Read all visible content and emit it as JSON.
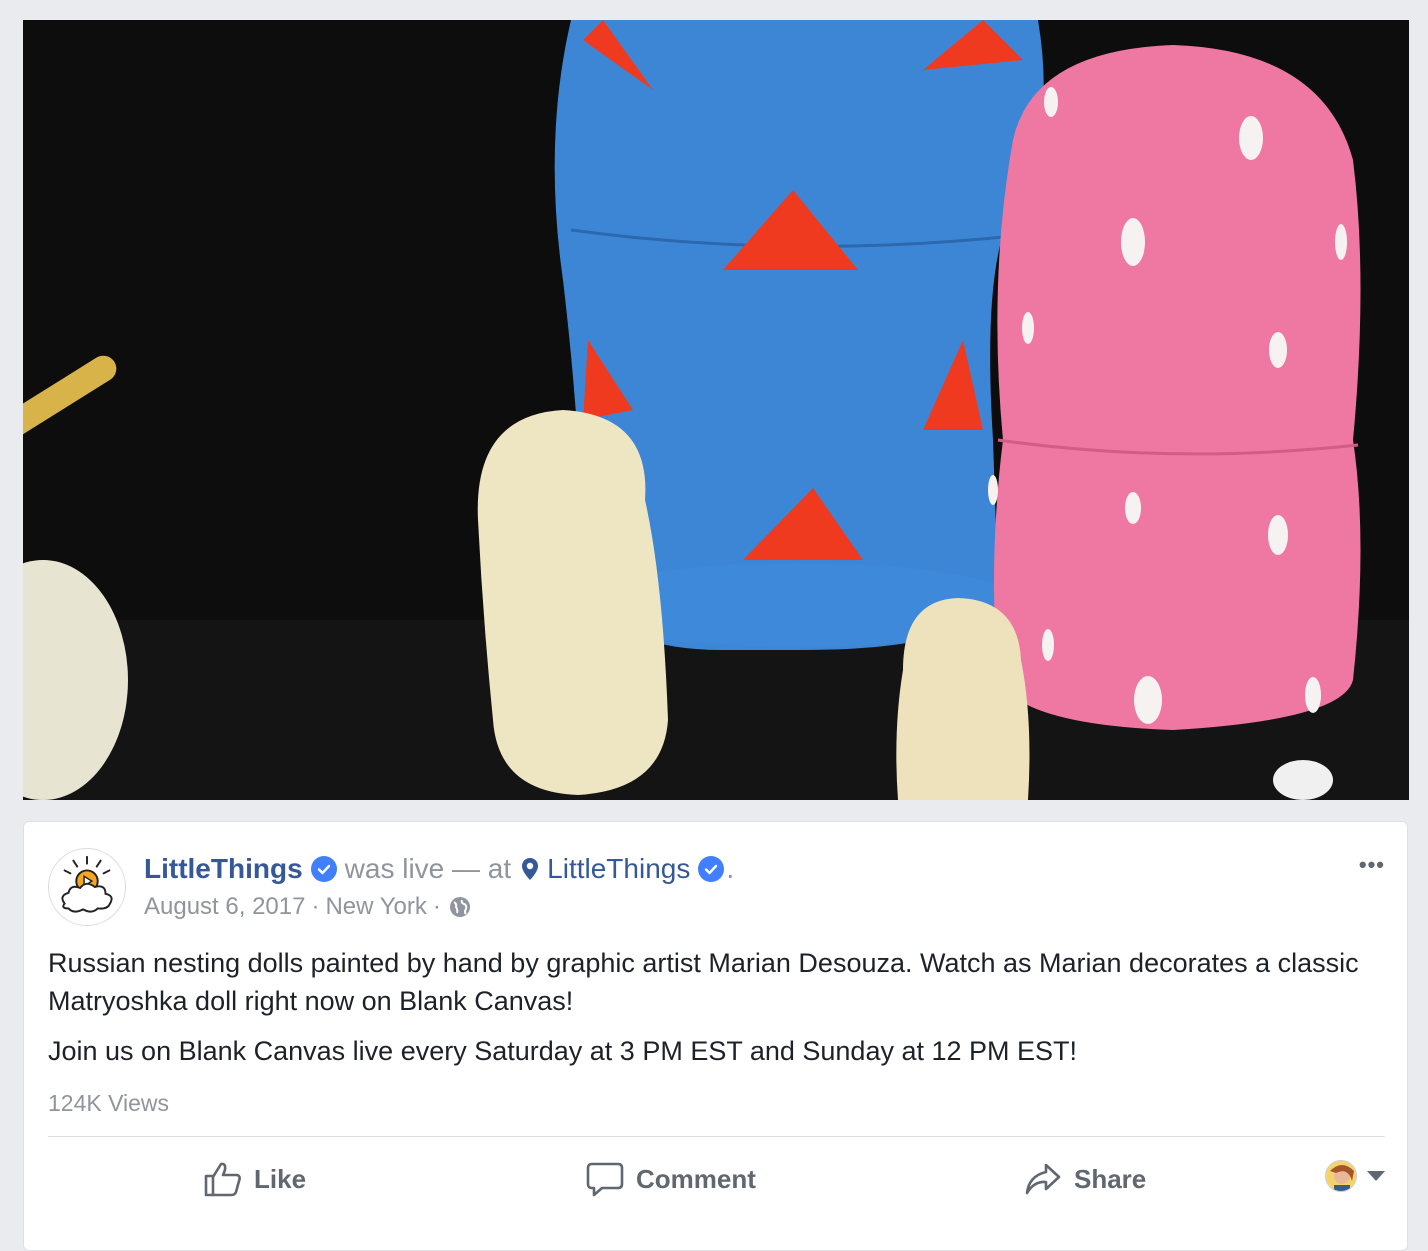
{
  "post": {
    "page_name": "LittleThings",
    "was_live": "was live — at",
    "location_name": "LittleThings",
    "period": ".",
    "date": "August 6, 2017",
    "separator1": "·",
    "place": "New York",
    "separator2": "·",
    "more": "•••",
    "body_paragraph_1": "Russian nesting dolls painted by hand by graphic artist Marian Desouza. Watch as Marian decorates a classic Matryoshka doll right now on Blank Canvas!",
    "body_paragraph_2": "Join us on Blank Canvas live every Saturday at 3 PM EST and Sunday at 12 PM EST!",
    "views": "124K Views"
  },
  "actions": {
    "like": "Like",
    "comment": "Comment",
    "share": "Share"
  },
  "icons": {
    "verified": "verified-badge-icon",
    "pin": "location-pin-icon",
    "globe": "globe-icon",
    "like": "thumbs-up-icon",
    "comment": "comment-bubble-icon",
    "share": "share-arrow-icon"
  },
  "colors": {
    "link": "#365899",
    "verified": "#4080ff",
    "meta": "#90949c",
    "text": "#1d2129"
  }
}
